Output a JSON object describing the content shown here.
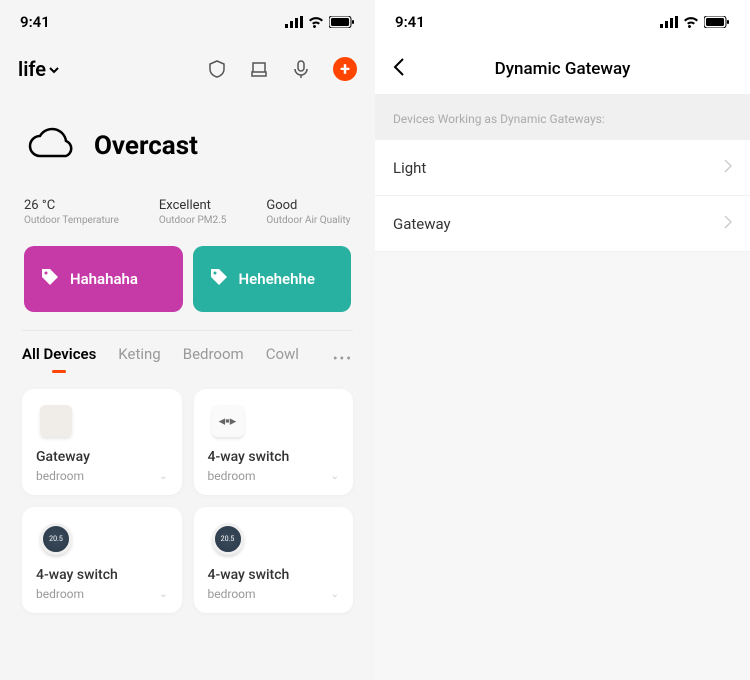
{
  "status": {
    "time": "9:41"
  },
  "left": {
    "header": {
      "title": "life"
    },
    "weather": {
      "condition": "Overcast",
      "metrics": [
        {
          "value": "26 °C",
          "label": "Outdoor Temperature"
        },
        {
          "value": "Excellent",
          "label": "Outdoor PM2.5"
        },
        {
          "value": "Good",
          "label": "Outdoor Air Quality"
        }
      ]
    },
    "scenes": [
      {
        "name": "Hahahaha",
        "color": "#c63aa8"
      },
      {
        "name": "Hehehehhe",
        "color": "#28b0a0"
      }
    ],
    "tabs": [
      {
        "label": "All Devices",
        "active": true
      },
      {
        "label": "Keting",
        "active": false
      },
      {
        "label": "Bedroom",
        "active": false
      },
      {
        "label": "Cowl",
        "active": false
      }
    ],
    "devices": [
      {
        "name": "Gateway",
        "room": "bedroom",
        "icon": "gateway"
      },
      {
        "name": "4-way switch",
        "room": "bedroom",
        "icon": "switch"
      },
      {
        "name": "4-way switch",
        "room": "bedroom",
        "icon": "thermo",
        "reading": "20.5"
      },
      {
        "name": "4-way switch",
        "room": "bedroom",
        "icon": "thermo",
        "reading": "20.5"
      }
    ]
  },
  "right": {
    "title": "Dynamic Gateway",
    "section_header": "Devices Working as Dynamic Gateways:",
    "items": [
      {
        "label": "Light"
      },
      {
        "label": "Gateway"
      }
    ]
  }
}
